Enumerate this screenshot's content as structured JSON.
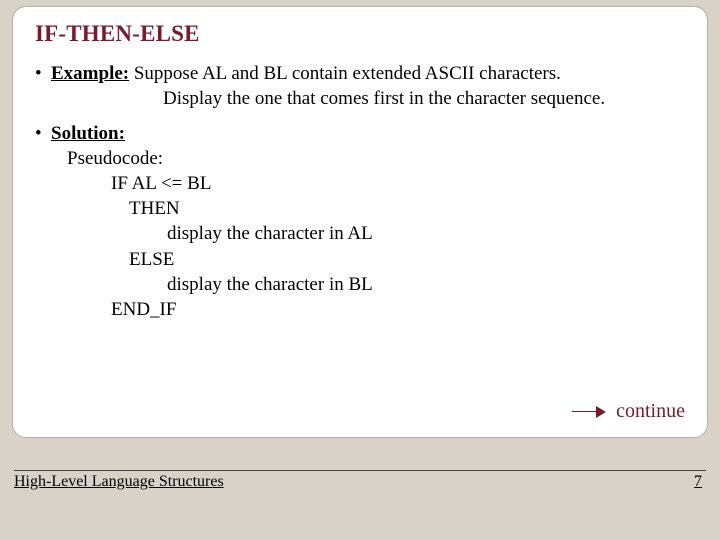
{
  "title": "IF-THEN-ELSE",
  "example": {
    "label": "Example:",
    "line1_rest": " Suppose AL and BL contain extended ASCII characters.",
    "line2": "Display the one that comes first in the character sequence."
  },
  "solution": {
    "label": "Solution:",
    "pseudocode_label": "Pseudocode:",
    "lines": {
      "if": "IF AL <= BL",
      "then": "THEN",
      "disp_al": "display the character in AL",
      "else": "ELSE",
      "disp_bl": "display the character in BL",
      "endif": "END_IF"
    }
  },
  "continue_label": "continue",
  "footer": {
    "title": "High-Level Language Structures",
    "page": "7"
  }
}
